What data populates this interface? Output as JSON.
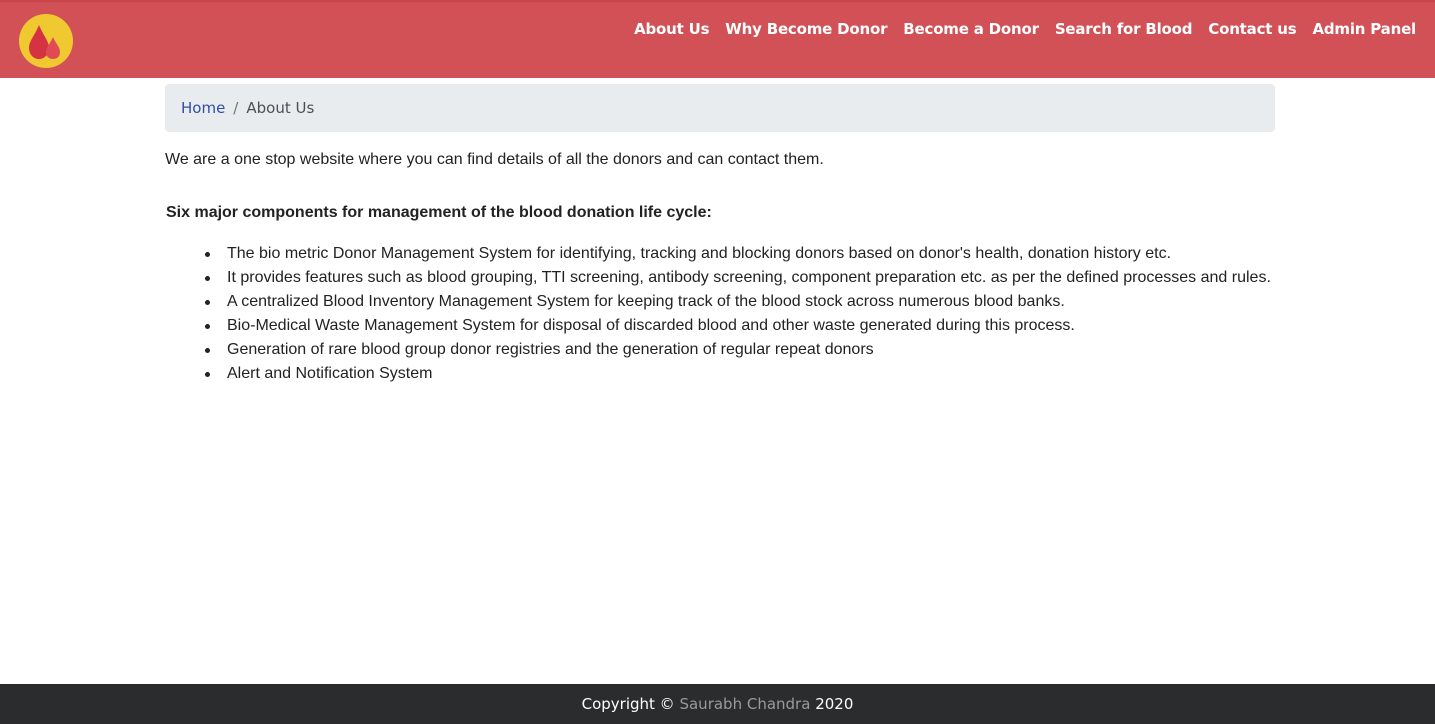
{
  "brand": {
    "logo_icon": "blood-drop-icon",
    "colors": {
      "primary": "#d15157",
      "logo_bg": "#f0c930",
      "drop": "#d63342"
    }
  },
  "nav": {
    "items": [
      {
        "label": "About Us"
      },
      {
        "label": "Why Become Donor"
      },
      {
        "label": "Become a Donor"
      },
      {
        "label": "Search for Blood"
      },
      {
        "label": "Contact us"
      },
      {
        "label": "Admin Panel"
      }
    ]
  },
  "breadcrumb": {
    "home": "Home",
    "separator": "/",
    "current": "About Us"
  },
  "content": {
    "intro": "We are a one stop website where you can find details of all the donors and can contact them.",
    "heading": "Six major components for management of the blood donation life cycle:",
    "items": [
      "The bio metric Donor Management System for identifying, tracking and blocking donors based on donor's health, donation history etc.",
      "It provides features such as blood grouping, TTI screening, antibody screening, component preparation etc. as per the defined processes and rules.",
      "A centralized Blood Inventory Management System for keeping track of the blood stock across numerous blood banks.",
      "Bio-Medical Waste Management System for disposal of discarded blood and other waste generated during this process.",
      "Generation of rare blood group donor registries and the generation of regular repeat donors",
      "Alert and Notification System"
    ]
  },
  "footer": {
    "prefix": "Copyright ©",
    "author": "Saurabh Chandra",
    "year": "2020"
  }
}
